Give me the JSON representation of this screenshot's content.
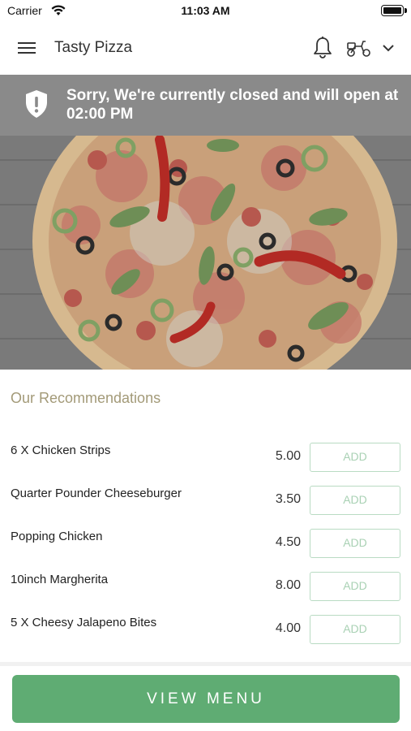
{
  "status_bar": {
    "carrier": "Carrier",
    "time": "11:03 AM"
  },
  "header": {
    "title": "Tasty Pizza",
    "icons": [
      "hamburger-menu-icon",
      "bell-icon",
      "scooter-icon",
      "chevron-down-icon"
    ]
  },
  "closed_banner": {
    "message": "Sorry, We're currently closed and will open at 02:00 PM",
    "icon": "shield-alert-icon",
    "background": "#8a8a8a"
  },
  "hero": {
    "image": "pizza-photo"
  },
  "recommendations": {
    "title": "Our Recommendations",
    "add_label": "ADD",
    "items": [
      {
        "name": "6 X Chicken Strips",
        "price": "5.00"
      },
      {
        "name": "Quarter Pounder Cheeseburger",
        "price": "3.50"
      },
      {
        "name": "Popping Chicken",
        "price": "4.50"
      },
      {
        "name": "10inch Margherita",
        "price": "8.00"
      },
      {
        "name": "5 X Cheesy Jalapeno Bites",
        "price": "4.00"
      }
    ]
  },
  "footer": {
    "view_menu_label": "VIEW MENU",
    "accent": "#5fac73"
  }
}
